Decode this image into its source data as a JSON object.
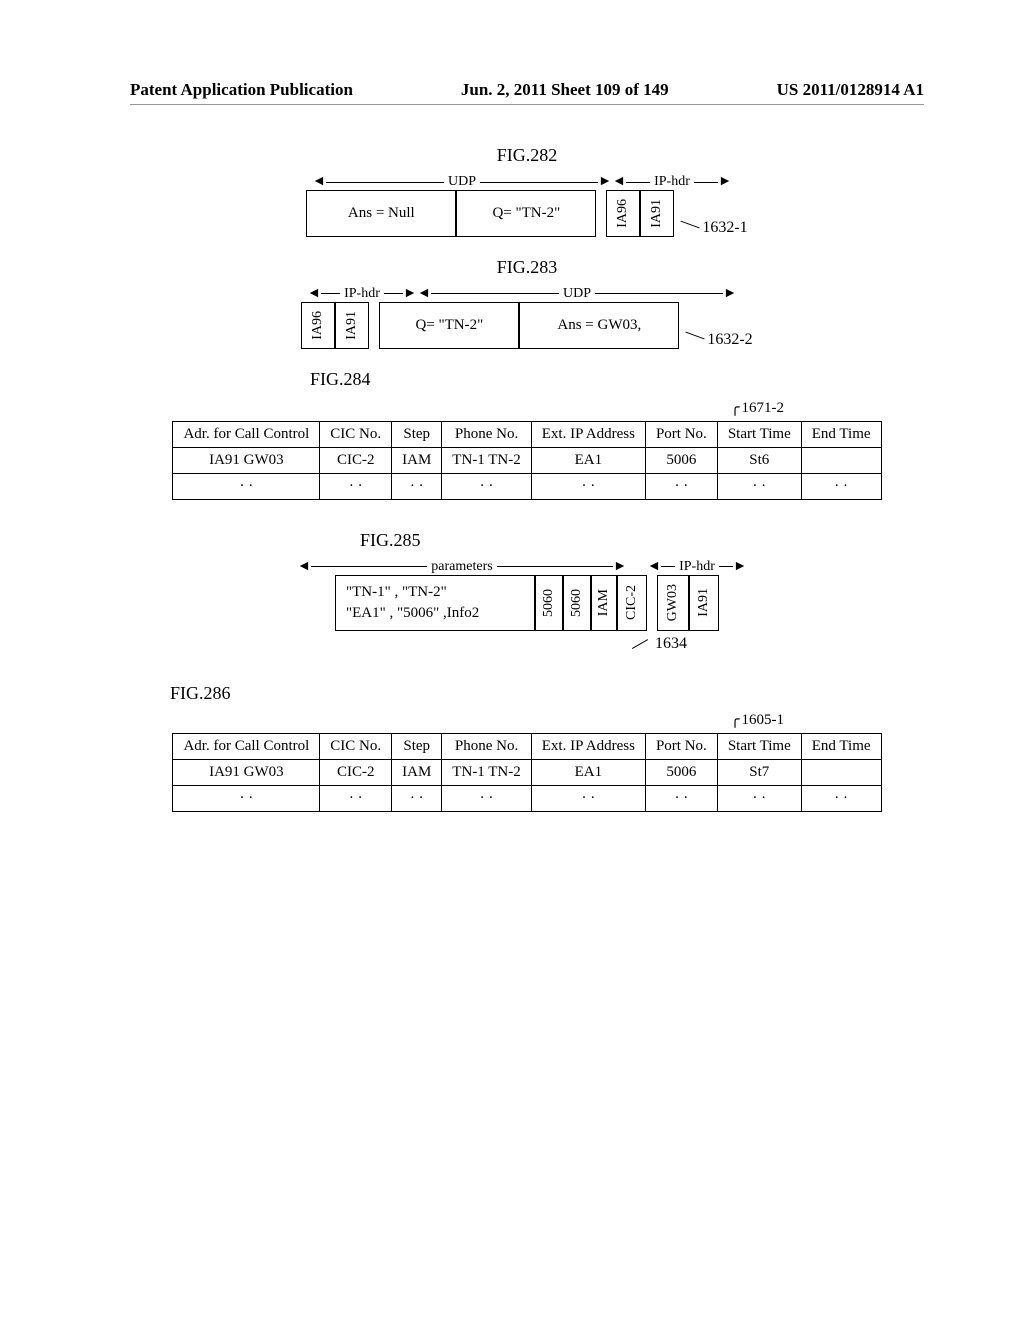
{
  "header": {
    "left": "Patent Application Publication",
    "center": "Jun. 2, 2011  Sheet 109 of 149",
    "right": "US 2011/0128914 A1"
  },
  "fig282": {
    "title": "FIG.282",
    "udp_label": "UDP",
    "iphdr_label": "IP-hdr",
    "ans": "Ans = Null",
    "q": "Q= \"TN-2\"",
    "ip1": "IA96",
    "ip2": "IA91",
    "ref": "1632-1"
  },
  "fig283": {
    "title": "FIG.283",
    "udp_label": "UDP",
    "iphdr_label": "IP-hdr",
    "ip1": "IA96",
    "ip2": "IA91",
    "q": "Q= \"TN-2\"",
    "ans": "Ans = GW03,",
    "ref": "1632-2"
  },
  "fig284": {
    "title": "FIG.284",
    "ref": "1671-2",
    "headers": [
      "Adr. for Call Control",
      "CIC No.",
      "Step",
      "Phone No.",
      "Ext. IP Address",
      "Port No.",
      "Start Time",
      "End Time"
    ],
    "row": [
      "IA91 GW03",
      "CIC-2",
      "IAM",
      "TN-1 TN-2",
      "EA1",
      "5006",
      "St6",
      ""
    ]
  },
  "fig285": {
    "title": "FIG.285",
    "params_label": "parameters",
    "iphdr_label": "IP-hdr",
    "params_line1": "\"TN-1\" ,  \"TN-2\"",
    "params_line2": "\"EA1\" , \"5006\" ,Info2",
    "c1": "5060",
    "c2": "5060",
    "c3": "IAM",
    "c4": "CIC-2",
    "c5": "GW03",
    "c6": "IA91",
    "ref": "1634"
  },
  "fig286": {
    "title": "FIG.286",
    "ref": "1605-1",
    "headers": [
      "Adr. for Call Control",
      "CIC No.",
      "Step",
      "Phone No.",
      "Ext. IP Address",
      "Port No.",
      "Start Time",
      "End Time"
    ],
    "row": [
      "IA91 GW03",
      "CIC-2",
      "IAM",
      "TN-1 TN-2",
      "EA1",
      "5006",
      "St7",
      ""
    ]
  }
}
